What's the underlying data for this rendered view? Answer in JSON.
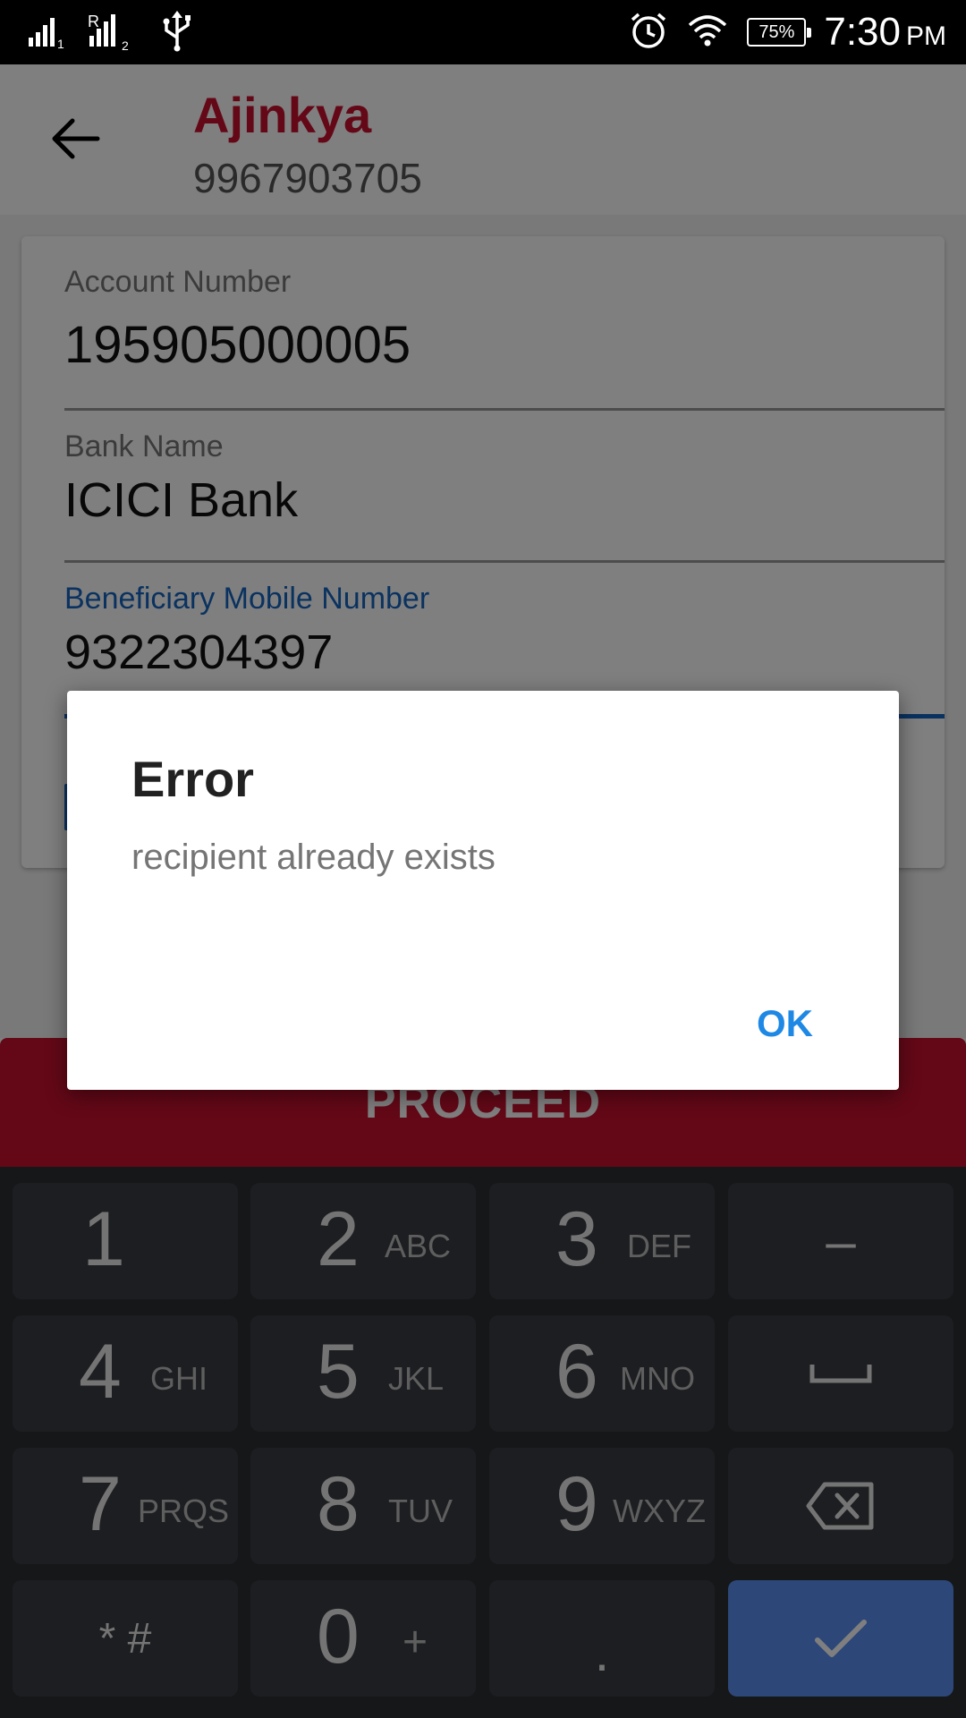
{
  "status_bar": {
    "sim1_label": "1",
    "sim2_label": "2",
    "sim2_prefix": "R",
    "battery": "75%",
    "time": "7:30",
    "ampm": "PM",
    "icons": [
      "signal-icon",
      "signal-roaming-icon",
      "usb-icon",
      "alarm-icon",
      "wifi-icon",
      "battery-icon"
    ]
  },
  "appbar": {
    "contact_name": "Ajinkya",
    "contact_phone": "9967903705",
    "name_color": "#c8102e"
  },
  "form": {
    "account_number": {
      "label": "Account Number",
      "value": "195905000005"
    },
    "bank_name": {
      "label": "Bank Name",
      "value": "ICICI Bank"
    },
    "mobile_number": {
      "label": "Beneficiary Mobile Number",
      "value": "9322304397"
    }
  },
  "proceed_label": "PROCEED",
  "dialog": {
    "title": "Error",
    "message": "recipient already exists",
    "ok_label": "OK"
  },
  "keypad": {
    "keys": [
      {
        "digit": "1",
        "letters": ""
      },
      {
        "digit": "2",
        "letters": "ABC"
      },
      {
        "digit": "3",
        "letters": "DEF"
      },
      {
        "glyph": "–"
      },
      {
        "digit": "4",
        "letters": "GHI"
      },
      {
        "digit": "5",
        "letters": "JKL"
      },
      {
        "digit": "6",
        "letters": "MNO"
      },
      {
        "glyph": "space"
      },
      {
        "digit": "7",
        "letters": "PRQS"
      },
      {
        "digit": "8",
        "letters": "TUV"
      },
      {
        "digit": "9",
        "letters": "WXYZ"
      },
      {
        "glyph": "backspace"
      },
      {
        "glyph": "* #"
      },
      {
        "digit": "0",
        "letters": "+"
      },
      {
        "glyph": "."
      },
      {
        "glyph": "✓"
      }
    ]
  },
  "colors": {
    "accent_red": "#c8102e",
    "accent_blue": "#1565c0",
    "ok_blue": "#1e88e5",
    "confirm_key": "#5c8ef2"
  }
}
